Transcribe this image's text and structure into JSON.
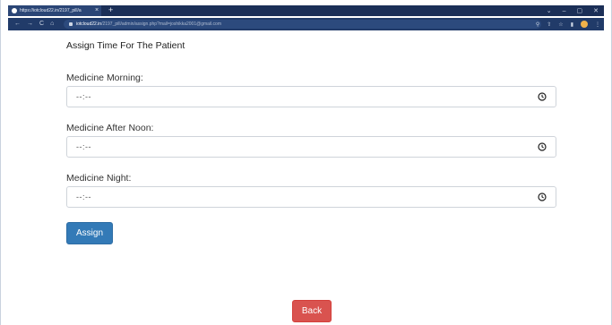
{
  "browser": {
    "tab_title": "https://iotcloud22.in/2197_pill/a",
    "tab_close": "×",
    "new_tab": "+",
    "url_host": "iotcloud22.in",
    "url_path": "/2197_pill/admin/assign.php?mail=joshikka2001@gmail.com",
    "window_minimize": "–",
    "window_maximize": "▢",
    "window_close": "✕",
    "chevron": "⌄"
  },
  "page": {
    "title": "Assign Time For The Patient",
    "fields": [
      {
        "label": "Medicine Morning:",
        "value": "--:--"
      },
      {
        "label": "Medicine After Noon:",
        "value": "--:--"
      },
      {
        "label": "Medicine Night:",
        "value": "--:--"
      }
    ],
    "assign_label": "Assign",
    "back_label": "Back"
  },
  "colors": {
    "primary": "#337ab7",
    "danger": "#d9534f",
    "browser_frame": "#1b2f57"
  }
}
